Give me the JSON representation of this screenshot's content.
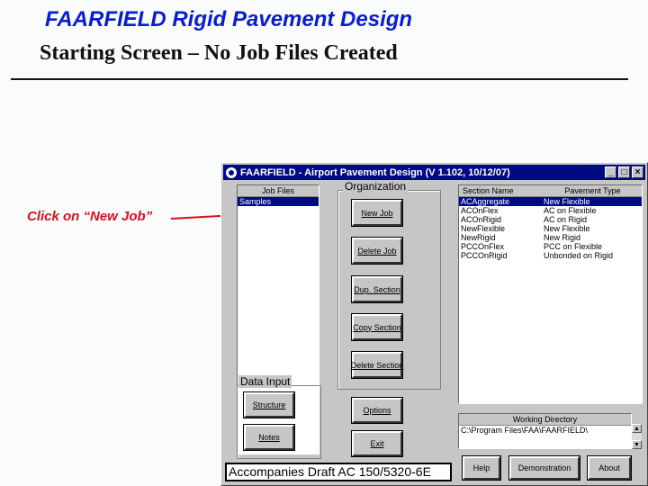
{
  "slide": {
    "title_line1": "FAARFIELD Rigid Pavement Design",
    "title_line2": "Starting Screen – No Job Files Created",
    "callout": "Click on “New Job”"
  },
  "window": {
    "title": "FAARFIELD - Airport Pavement Design (V 1.102, 10/12/07)",
    "controls": [
      "_",
      "□",
      "×"
    ]
  },
  "job_files": {
    "header": "Job Files",
    "items": [
      "Samples"
    ],
    "selected_index": 0
  },
  "sections": {
    "columns": [
      "Section Name",
      "Pavement Type"
    ],
    "rows": [
      [
        "ACAggregate",
        "New Flexible"
      ],
      [
        "ACOnFlex",
        "AC on Flexible"
      ],
      [
        "ACOnRigid",
        "AC on Rigid"
      ],
      [
        "NewFlexible",
        "New Flexible"
      ],
      [
        "NewRigid",
        "New Rigid"
      ],
      [
        "PCCOnFlex",
        "PCC on Flexible"
      ],
      [
        "PCCOnRigid",
        "Unbonded on Rigid"
      ]
    ],
    "selected_index": 0
  },
  "organization": {
    "label": "Organization",
    "buttons": {
      "new_job": "New Job",
      "delete_job": "Delete Job",
      "dup_section": "Dup. Section",
      "copy_section": "Copy Section",
      "delete_section": "Delete Section"
    }
  },
  "data_input": {
    "label": "Data Input",
    "structure": "Structure",
    "notes": "Notes"
  },
  "buttons": {
    "options": "Options",
    "exit": "Exit",
    "help": "Help",
    "demonstration": "Demonstration",
    "about": "About"
  },
  "working_directory": {
    "label": "Working Directory",
    "path": "C:\\Program Files\\FAA\\FAARFIELD\\"
  },
  "caption": "Accompanies Draft AC 150/5320-6E",
  "colors": {
    "title_blue": "#0a1cd0",
    "callout_red": "#d8101c",
    "titlebar": "#000a84",
    "selection": "#000a84",
    "face": "#c6c6c6"
  }
}
